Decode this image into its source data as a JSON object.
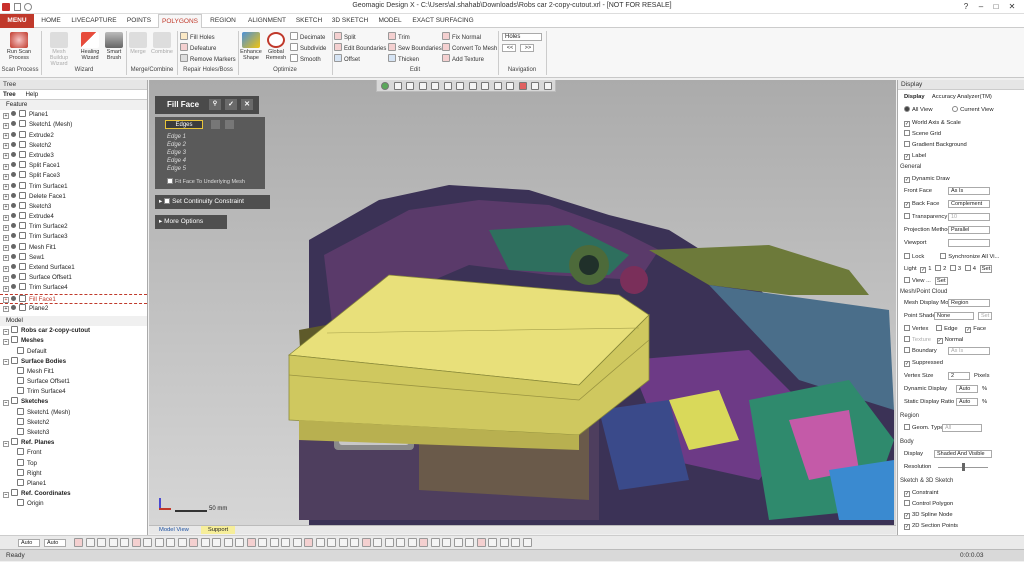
{
  "window": {
    "title": "Geomagic Design X - C:\\Users\\al.shahab\\Downloads\\Robs car 2-copy-cutout.xrl - [NOT FOR RESALE]"
  },
  "menu": [
    "MENU",
    "HOME",
    "LIVECAPTURE",
    "POINTS",
    "POLYGONS",
    "REGION",
    "ALIGNMENT",
    "SKETCH",
    "3D SKETCH",
    "MODEL",
    "EXACT SURFACING"
  ],
  "ribbon": {
    "scan_process": {
      "btn": "Run Scan Process",
      "label": "Scan Process"
    },
    "wizard": {
      "btns": [
        "Mesh Buildup Wizard",
        "Healing Wizard",
        "Smart Brush"
      ],
      "label": "Wizard"
    },
    "merge": {
      "btns": [
        "Merge",
        "Combine"
      ],
      "label": "Merge/Combine"
    },
    "repair": {
      "items": [
        "Fill Holes",
        "Defeature",
        "Remove Markers"
      ],
      "label": "Repair Holes/Boss"
    },
    "optimize": {
      "btns": [
        "Enhance Shape",
        "Global Remesh"
      ],
      "items": [
        "Decimate",
        "Subdivide",
        "Smooth"
      ],
      "label": "Optimize"
    },
    "edit": {
      "col1": [
        "Split",
        "Edit Boundaries",
        "Offset"
      ],
      "col2": [
        "Trim",
        "Sew Boundaries",
        "Thicken"
      ],
      "col3": [
        "Fix Normal",
        "Convert To Mesh",
        "Add Texture"
      ],
      "label": "Edit"
    },
    "navigation": {
      "select": "Holes",
      "prev": "<<",
      "next": ">>",
      "label": "Navigation"
    }
  },
  "tree": {
    "header": "Tree",
    "tabs": [
      "Tree",
      "Help"
    ],
    "feature_label": "Feature",
    "features": [
      "Plane1",
      "Sketch1 (Mesh)",
      "Extrude2",
      "Sketch2",
      "Extrude3",
      "Split Face1",
      "Split Face3",
      "Trim Surface1",
      "Delete Face1",
      "Sketch3",
      "Extrude4",
      "Trim Surface2",
      "Trim Surface3",
      "Mesh Fit1",
      "Sew1",
      "Extend Surface1",
      "Surface Offset1",
      "Trim Surface4",
      "Fill Face1",
      "Plane2"
    ],
    "model_label": "Model",
    "model": [
      {
        "t": "Robs car 2-copy-cutout",
        "lvl": 0,
        "bold": true
      },
      {
        "t": "Meshes",
        "lvl": 0,
        "bold": true
      },
      {
        "t": "Default",
        "lvl": 1
      },
      {
        "t": "Surface Bodies",
        "lvl": 0,
        "bold": true
      },
      {
        "t": "Mesh Fit1",
        "lvl": 1
      },
      {
        "t": "Surface Offset1",
        "lvl": 1
      },
      {
        "t": "Trim Surface4",
        "lvl": 1
      },
      {
        "t": "Sketches",
        "lvl": 0,
        "bold": true
      },
      {
        "t": "Sketch1 (Mesh)",
        "lvl": 1
      },
      {
        "t": "Sketch2",
        "lvl": 1
      },
      {
        "t": "Sketch3",
        "lvl": 1
      },
      {
        "t": "Ref. Planes",
        "lvl": 0,
        "bold": true
      },
      {
        "t": "Front",
        "lvl": 1
      },
      {
        "t": "Top",
        "lvl": 1
      },
      {
        "t": "Right",
        "lvl": 1
      },
      {
        "t": "Plane1",
        "lvl": 1
      },
      {
        "t": "Ref. Coordinates",
        "lvl": 0,
        "bold": true
      },
      {
        "t": "Origin",
        "lvl": 1
      }
    ]
  },
  "fillface": {
    "title": "Fill Face",
    "edges_label": "Edges",
    "edges": [
      "Edge 1",
      "Edge 2",
      "Edge 3",
      "Edge 4",
      "Edge 5"
    ],
    "fit_option": "Fit Face To Underlying Mesh",
    "continuity": "Set Continuity Constraint",
    "more": "More Options"
  },
  "viewport": {
    "scale": "50 mm",
    "tabs": [
      "Model View",
      "Support"
    ]
  },
  "display": {
    "header": "Display",
    "tabs": [
      "Display",
      "Accuracy Analyzer(TM)"
    ],
    "view_opts": [
      "All View",
      "Current View"
    ],
    "checks": [
      "World Axis & Scale",
      "Scene Grid",
      "Gradient Background",
      "Label"
    ],
    "general": "General",
    "dynamic_draw": "Dynamic Draw",
    "front_face": "Front Face",
    "front_face_val": "As Is",
    "back_face": "Back Face",
    "back_face_val": "Complement",
    "transparency": "Transparency",
    "transparency_val": "10",
    "projection": "Projection Method",
    "projection_val": "Parallel",
    "viewport": "Viewport",
    "lock": "Lock",
    "sync": "Synchronize All Vi...",
    "light": "Light",
    "light_opts": [
      "1",
      "2",
      "3",
      "4"
    ],
    "light_set": "Set",
    "view": "View ...",
    "view_set": "Set",
    "mesh_section": "Mesh/Point Cloud",
    "mesh_mode": "Mesh Display Mode",
    "mesh_mode_val": "Region",
    "point_shader": "Point Shader",
    "point_shader_val": "None",
    "point_shader_btn": "Set",
    "vertex": "Vertex",
    "edge": "Edge",
    "face": "Face",
    "texture": "Texture",
    "normal": "Normal",
    "boundary": "Boundary",
    "boundary_val": "As Is",
    "suppressed": "Suppressed",
    "vertex_size": "Vertex Size",
    "vertex_size_val": "2",
    "pixels": "Pixels",
    "dyn_display": "Dynamic Display",
    "dyn_display_val": "Auto",
    "static_ratio": "Static Display Ratio",
    "static_ratio_val": "Auto",
    "pct": "%",
    "region_section": "Region",
    "geom_type": "Geom. Type",
    "geom_type_val": "All",
    "body_section": "Body",
    "body_display": "Display",
    "body_display_val": "Shaded And Visible",
    "resolution": "Resolution",
    "sketch_section": "Sketch & 3D Sketch",
    "sketch_checks": [
      "Constraint",
      "Control Polygon",
      "3D Spline Node",
      "2D Section Points"
    ]
  },
  "status": {
    "left": "Ready",
    "right": "0:0:0.03"
  },
  "bottom_combos": [
    "Auto",
    "Auto"
  ],
  "colors": {
    "brand_red": "#c0392b",
    "fill_yellow": "#e8e07a",
    "panel_dark": "#4a4a4a"
  }
}
